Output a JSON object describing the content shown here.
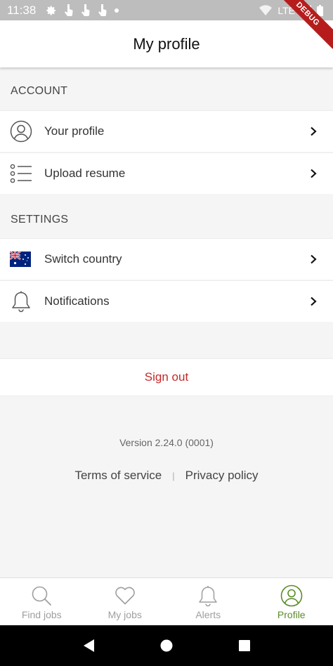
{
  "status_bar": {
    "time": "11:38",
    "network": "LTE"
  },
  "debug_banner": "DEBUG",
  "app_bar": {
    "title": "My profile"
  },
  "sections": [
    {
      "title": "ACCOUNT",
      "items": [
        {
          "label": "Your profile",
          "icon": "user-circle-icon"
        },
        {
          "label": "Upload resume",
          "icon": "list-icon"
        }
      ]
    },
    {
      "title": "SETTINGS",
      "items": [
        {
          "label": "Switch country",
          "icon": "australia-flag-icon"
        },
        {
          "label": "Notifications",
          "icon": "bell-icon"
        }
      ]
    }
  ],
  "sign_out": "Sign out",
  "version": "Version 2.24.0 (0001)",
  "links": {
    "terms": "Terms of service",
    "separator": "|",
    "privacy": "Privacy policy"
  },
  "bottom_nav": [
    {
      "label": "Find jobs",
      "icon": "search-icon",
      "active": false
    },
    {
      "label": "My jobs",
      "icon": "heart-icon",
      "active": false
    },
    {
      "label": "Alerts",
      "icon": "bell-icon",
      "active": false
    },
    {
      "label": "Profile",
      "icon": "profile-icon",
      "active": true
    }
  ],
  "colors": {
    "accent": "#5b8c2a",
    "sign_out": "#c62828",
    "status_bar": "#bdbdbd"
  }
}
